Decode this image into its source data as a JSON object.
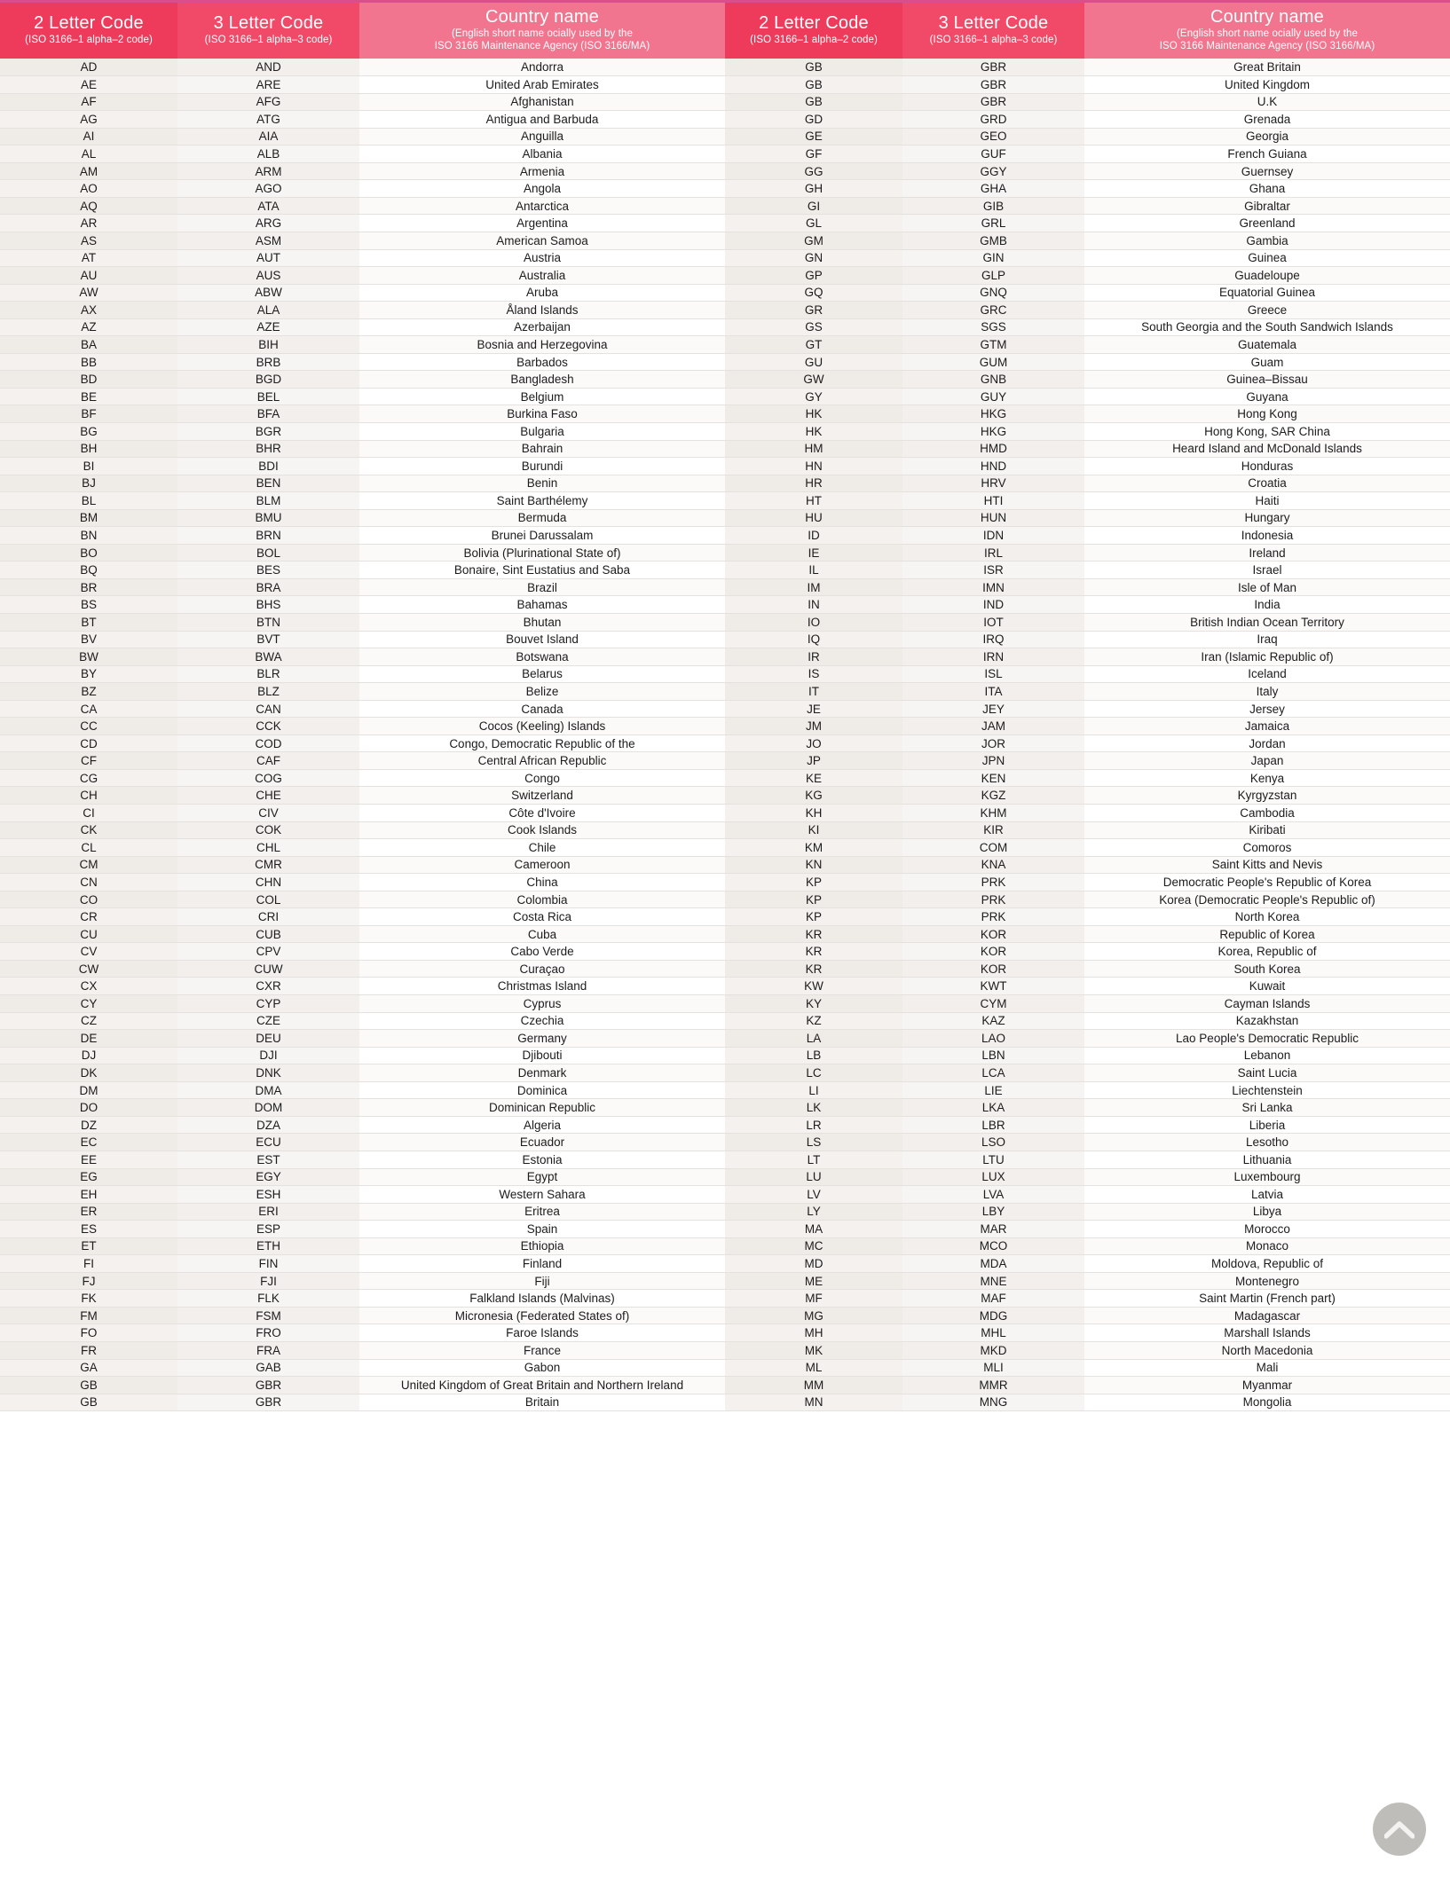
{
  "header": {
    "col_2letter_title": "2 Letter Code",
    "col_2letter_sub": "(ISO 3166–1 alpha–2 code)",
    "col_3letter_title": "3 Letter Code",
    "col_3letter_sub": "(ISO 3166–1 alpha–3 code)",
    "col_country_title": "Country name",
    "col_country_sub_line1": "(English short name ocially used by the",
    "col_country_sub_line2": "ISO 3166 Maintenance Agency (ISO 3166/MA)"
  },
  "colors": {
    "header_2letter_bg": "#ef3b5b",
    "header_3letter_bg": "#f04a68",
    "header_country_bg": "#f2758f",
    "header_top_border": "#d94f8e",
    "row_odd_code_bg": "#efebe7",
    "row_even_code_bg": "#f4f1ee",
    "row_country_bg": "#ffffff",
    "row_border": "#e4e1de",
    "text": "#1c1c1c",
    "scroll_button_bg": "#b5b2ae"
  },
  "scroll_top_button": {
    "icon": "chevron-up-icon",
    "label": ""
  },
  "chart_data": {
    "type": "table",
    "title": "ISO 3166 Country Codes",
    "columns": [
      "2 Letter Code",
      "3 Letter Code",
      "Country name"
    ],
    "left_column_rows": [
      [
        "AD",
        "AND",
        "Andorra"
      ],
      [
        "AE",
        "ARE",
        "United Arab Emirates"
      ],
      [
        "AF",
        "AFG",
        "Afghanistan"
      ],
      [
        "AG",
        "ATG",
        "Antigua and Barbuda"
      ],
      [
        "AI",
        "AIA",
        "Anguilla"
      ],
      [
        "AL",
        "ALB",
        "Albania"
      ],
      [
        "AM",
        "ARM",
        "Armenia"
      ],
      [
        "AO",
        "AGO",
        "Angola"
      ],
      [
        "AQ",
        "ATA",
        "Antarctica"
      ],
      [
        "AR",
        "ARG",
        "Argentina"
      ],
      [
        "AS",
        "ASM",
        "American Samoa"
      ],
      [
        "AT",
        "AUT",
        "Austria"
      ],
      [
        "AU",
        "AUS",
        "Australia"
      ],
      [
        "AW",
        "ABW",
        "Aruba"
      ],
      [
        "AX",
        "ALA",
        "Åland Islands"
      ],
      [
        "AZ",
        "AZE",
        "Azerbaijan"
      ],
      [
        "BA",
        "BIH",
        "Bosnia and Herzegovina"
      ],
      [
        "BB",
        "BRB",
        "Barbados"
      ],
      [
        "BD",
        "BGD",
        "Bangladesh"
      ],
      [
        "BE",
        "BEL",
        "Belgium"
      ],
      [
        "BF",
        "BFA",
        "Burkina Faso"
      ],
      [
        "BG",
        "BGR",
        "Bulgaria"
      ],
      [
        "BH",
        "BHR",
        "Bahrain"
      ],
      [
        "BI",
        "BDI",
        "Burundi"
      ],
      [
        "BJ",
        "BEN",
        "Benin"
      ],
      [
        "BL",
        "BLM",
        "Saint Barthélemy"
      ],
      [
        "BM",
        "BMU",
        "Bermuda"
      ],
      [
        "BN",
        "BRN",
        "Brunei Darussalam"
      ],
      [
        "BO",
        "BOL",
        "Bolivia (Plurinational State of)"
      ],
      [
        "BQ",
        "BES",
        "Bonaire, Sint Eustatius and Saba"
      ],
      [
        "BR",
        "BRA",
        "Brazil"
      ],
      [
        "BS",
        "BHS",
        "Bahamas"
      ],
      [
        "BT",
        "BTN",
        "Bhutan"
      ],
      [
        "BV",
        "BVT",
        "Bouvet Island"
      ],
      [
        "BW",
        "BWA",
        "Botswana"
      ],
      [
        "BY",
        "BLR",
        "Belarus"
      ],
      [
        "BZ",
        "BLZ",
        "Belize"
      ],
      [
        "CA",
        "CAN",
        "Canada"
      ],
      [
        "CC",
        "CCK",
        "Cocos (Keeling) Islands"
      ],
      [
        "CD",
        "COD",
        "Congo, Democratic Republic of the"
      ],
      [
        "CF",
        "CAF",
        "Central African Republic"
      ],
      [
        "CG",
        "COG",
        "Congo"
      ],
      [
        "CH",
        "CHE",
        "Switzerland"
      ],
      [
        "CI",
        "CIV",
        "Côte d'Ivoire"
      ],
      [
        "CK",
        "COK",
        "Cook Islands"
      ],
      [
        "CL",
        "CHL",
        "Chile"
      ],
      [
        "CM",
        "CMR",
        "Cameroon"
      ],
      [
        "CN",
        "CHN",
        "China"
      ],
      [
        "CO",
        "COL",
        "Colombia"
      ],
      [
        "CR",
        "CRI",
        "Costa Rica"
      ],
      [
        "CU",
        "CUB",
        "Cuba"
      ],
      [
        "CV",
        "CPV",
        "Cabo Verde"
      ],
      [
        "CW",
        "CUW",
        "Curaçao"
      ],
      [
        "CX",
        "CXR",
        "Christmas Island"
      ],
      [
        "CY",
        "CYP",
        "Cyprus"
      ],
      [
        "CZ",
        "CZE",
        "Czechia"
      ],
      [
        "DE",
        "DEU",
        "Germany"
      ],
      [
        "DJ",
        "DJI",
        "Djibouti"
      ],
      [
        "DK",
        "DNK",
        "Denmark"
      ],
      [
        "DM",
        "DMA",
        "Dominica"
      ],
      [
        "DO",
        "DOM",
        "Dominican Republic"
      ],
      [
        "DZ",
        "DZA",
        "Algeria"
      ],
      [
        "EC",
        "ECU",
        "Ecuador"
      ],
      [
        "EE",
        "EST",
        "Estonia"
      ],
      [
        "EG",
        "EGY",
        "Egypt"
      ],
      [
        "EH",
        "ESH",
        "Western Sahara"
      ],
      [
        "ER",
        "ERI",
        "Eritrea"
      ],
      [
        "ES",
        "ESP",
        "Spain"
      ],
      [
        "ET",
        "ETH",
        "Ethiopia"
      ],
      [
        "FI",
        "FIN",
        "Finland"
      ],
      [
        "FJ",
        "FJI",
        "Fiji"
      ],
      [
        "FK",
        "FLK",
        "Falkland Islands (Malvinas)"
      ],
      [
        "FM",
        "FSM",
        "Micronesia (Federated States of)"
      ],
      [
        "FO",
        "FRO",
        "Faroe Islands"
      ],
      [
        "FR",
        "FRA",
        "France"
      ],
      [
        "GA",
        "GAB",
        "Gabon"
      ],
      [
        "GB",
        "GBR",
        "United Kingdom of Great Britain and Northern Ireland"
      ],
      [
        "GB",
        "GBR",
        "Britain"
      ]
    ],
    "right_column_rows": [
      [
        "GB",
        "GBR",
        "Great Britain"
      ],
      [
        "GB",
        "GBR",
        "United Kingdom"
      ],
      [
        "GB",
        "GBR",
        "U.K"
      ],
      [
        "GD",
        "GRD",
        "Grenada"
      ],
      [
        "GE",
        "GEO",
        "Georgia"
      ],
      [
        "GF",
        "GUF",
        "French Guiana"
      ],
      [
        "GG",
        "GGY",
        "Guernsey"
      ],
      [
        "GH",
        "GHA",
        "Ghana"
      ],
      [
        "GI",
        "GIB",
        "Gibraltar"
      ],
      [
        "GL",
        "GRL",
        "Greenland"
      ],
      [
        "GM",
        "GMB",
        "Gambia"
      ],
      [
        "GN",
        "GIN",
        "Guinea"
      ],
      [
        "GP",
        "GLP",
        "Guadeloupe"
      ],
      [
        "GQ",
        "GNQ",
        "Equatorial Guinea"
      ],
      [
        "GR",
        "GRC",
        "Greece"
      ],
      [
        "GS",
        "SGS",
        "South Georgia and the South Sandwich Islands"
      ],
      [
        "GT",
        "GTM",
        "Guatemala"
      ],
      [
        "GU",
        "GUM",
        "Guam"
      ],
      [
        "GW",
        "GNB",
        "Guinea–Bissau"
      ],
      [
        "GY",
        "GUY",
        "Guyana"
      ],
      [
        "HK",
        "HKG",
        "Hong Kong"
      ],
      [
        "HK",
        "HKG",
        "Hong Kong, SAR China"
      ],
      [
        "HM",
        "HMD",
        "Heard Island and McDonald Islands"
      ],
      [
        "HN",
        "HND",
        "Honduras"
      ],
      [
        "HR",
        "HRV",
        "Croatia"
      ],
      [
        "HT",
        "HTI",
        "Haiti"
      ],
      [
        "HU",
        "HUN",
        "Hungary"
      ],
      [
        "ID",
        "IDN",
        "Indonesia"
      ],
      [
        "IE",
        "IRL",
        "Ireland"
      ],
      [
        "IL",
        "ISR",
        "Israel"
      ],
      [
        "IM",
        "IMN",
        "Isle of Man"
      ],
      [
        "IN",
        "IND",
        "India"
      ],
      [
        "IO",
        "IOT",
        "British Indian Ocean Territory"
      ],
      [
        "IQ",
        "IRQ",
        "Iraq"
      ],
      [
        "IR",
        "IRN",
        "Iran (Islamic Republic of)"
      ],
      [
        "IS",
        "ISL",
        "Iceland"
      ],
      [
        "IT",
        "ITA",
        "Italy"
      ],
      [
        "JE",
        "JEY",
        "Jersey"
      ],
      [
        "JM",
        "JAM",
        "Jamaica"
      ],
      [
        "JO",
        "JOR",
        "Jordan"
      ],
      [
        "JP",
        "JPN",
        "Japan"
      ],
      [
        "KE",
        "KEN",
        "Kenya"
      ],
      [
        "KG",
        "KGZ",
        "Kyrgyzstan"
      ],
      [
        "KH",
        "KHM",
        "Cambodia"
      ],
      [
        "KI",
        "KIR",
        "Kiribati"
      ],
      [
        "KM",
        "COM",
        "Comoros"
      ],
      [
        "KN",
        "KNA",
        "Saint Kitts and Nevis"
      ],
      [
        "KP",
        "PRK",
        "Democratic People's Republic of Korea"
      ],
      [
        "KP",
        "PRK",
        "Korea (Democratic People's Republic of)"
      ],
      [
        "KP",
        "PRK",
        "North Korea"
      ],
      [
        "KR",
        "KOR",
        "Republic of Korea"
      ],
      [
        "KR",
        "KOR",
        "Korea, Republic of"
      ],
      [
        "KR",
        "KOR",
        "South Korea"
      ],
      [
        "KW",
        "KWT",
        "Kuwait"
      ],
      [
        "KY",
        "CYM",
        "Cayman Islands"
      ],
      [
        "KZ",
        "KAZ",
        "Kazakhstan"
      ],
      [
        "LA",
        "LAO",
        "Lao People's Democratic Republic"
      ],
      [
        "LB",
        "LBN",
        "Lebanon"
      ],
      [
        "LC",
        "LCA",
        "Saint Lucia"
      ],
      [
        "LI",
        "LIE",
        "Liechtenstein"
      ],
      [
        "LK",
        "LKA",
        "Sri Lanka"
      ],
      [
        "LR",
        "LBR",
        "Liberia"
      ],
      [
        "LS",
        "LSO",
        "Lesotho"
      ],
      [
        "LT",
        "LTU",
        "Lithuania"
      ],
      [
        "LU",
        "LUX",
        "Luxembourg"
      ],
      [
        "LV",
        "LVA",
        "Latvia"
      ],
      [
        "LY",
        "LBY",
        "Libya"
      ],
      [
        "MA",
        "MAR",
        "Morocco"
      ],
      [
        "MC",
        "MCO",
        "Monaco"
      ],
      [
        "MD",
        "MDA",
        "Moldova, Republic of"
      ],
      [
        "ME",
        "MNE",
        "Montenegro"
      ],
      [
        "MF",
        "MAF",
        "Saint Martin (French part)"
      ],
      [
        "MG",
        "MDG",
        "Madagascar"
      ],
      [
        "MH",
        "MHL",
        "Marshall Islands"
      ],
      [
        "MK",
        "MKD",
        "North Macedonia"
      ],
      [
        "ML",
        "MLI",
        "Mali"
      ],
      [
        "MM",
        "MMR",
        "Myanmar"
      ],
      [
        "MN",
        "MNG",
        "Mongolia"
      ]
    ]
  }
}
